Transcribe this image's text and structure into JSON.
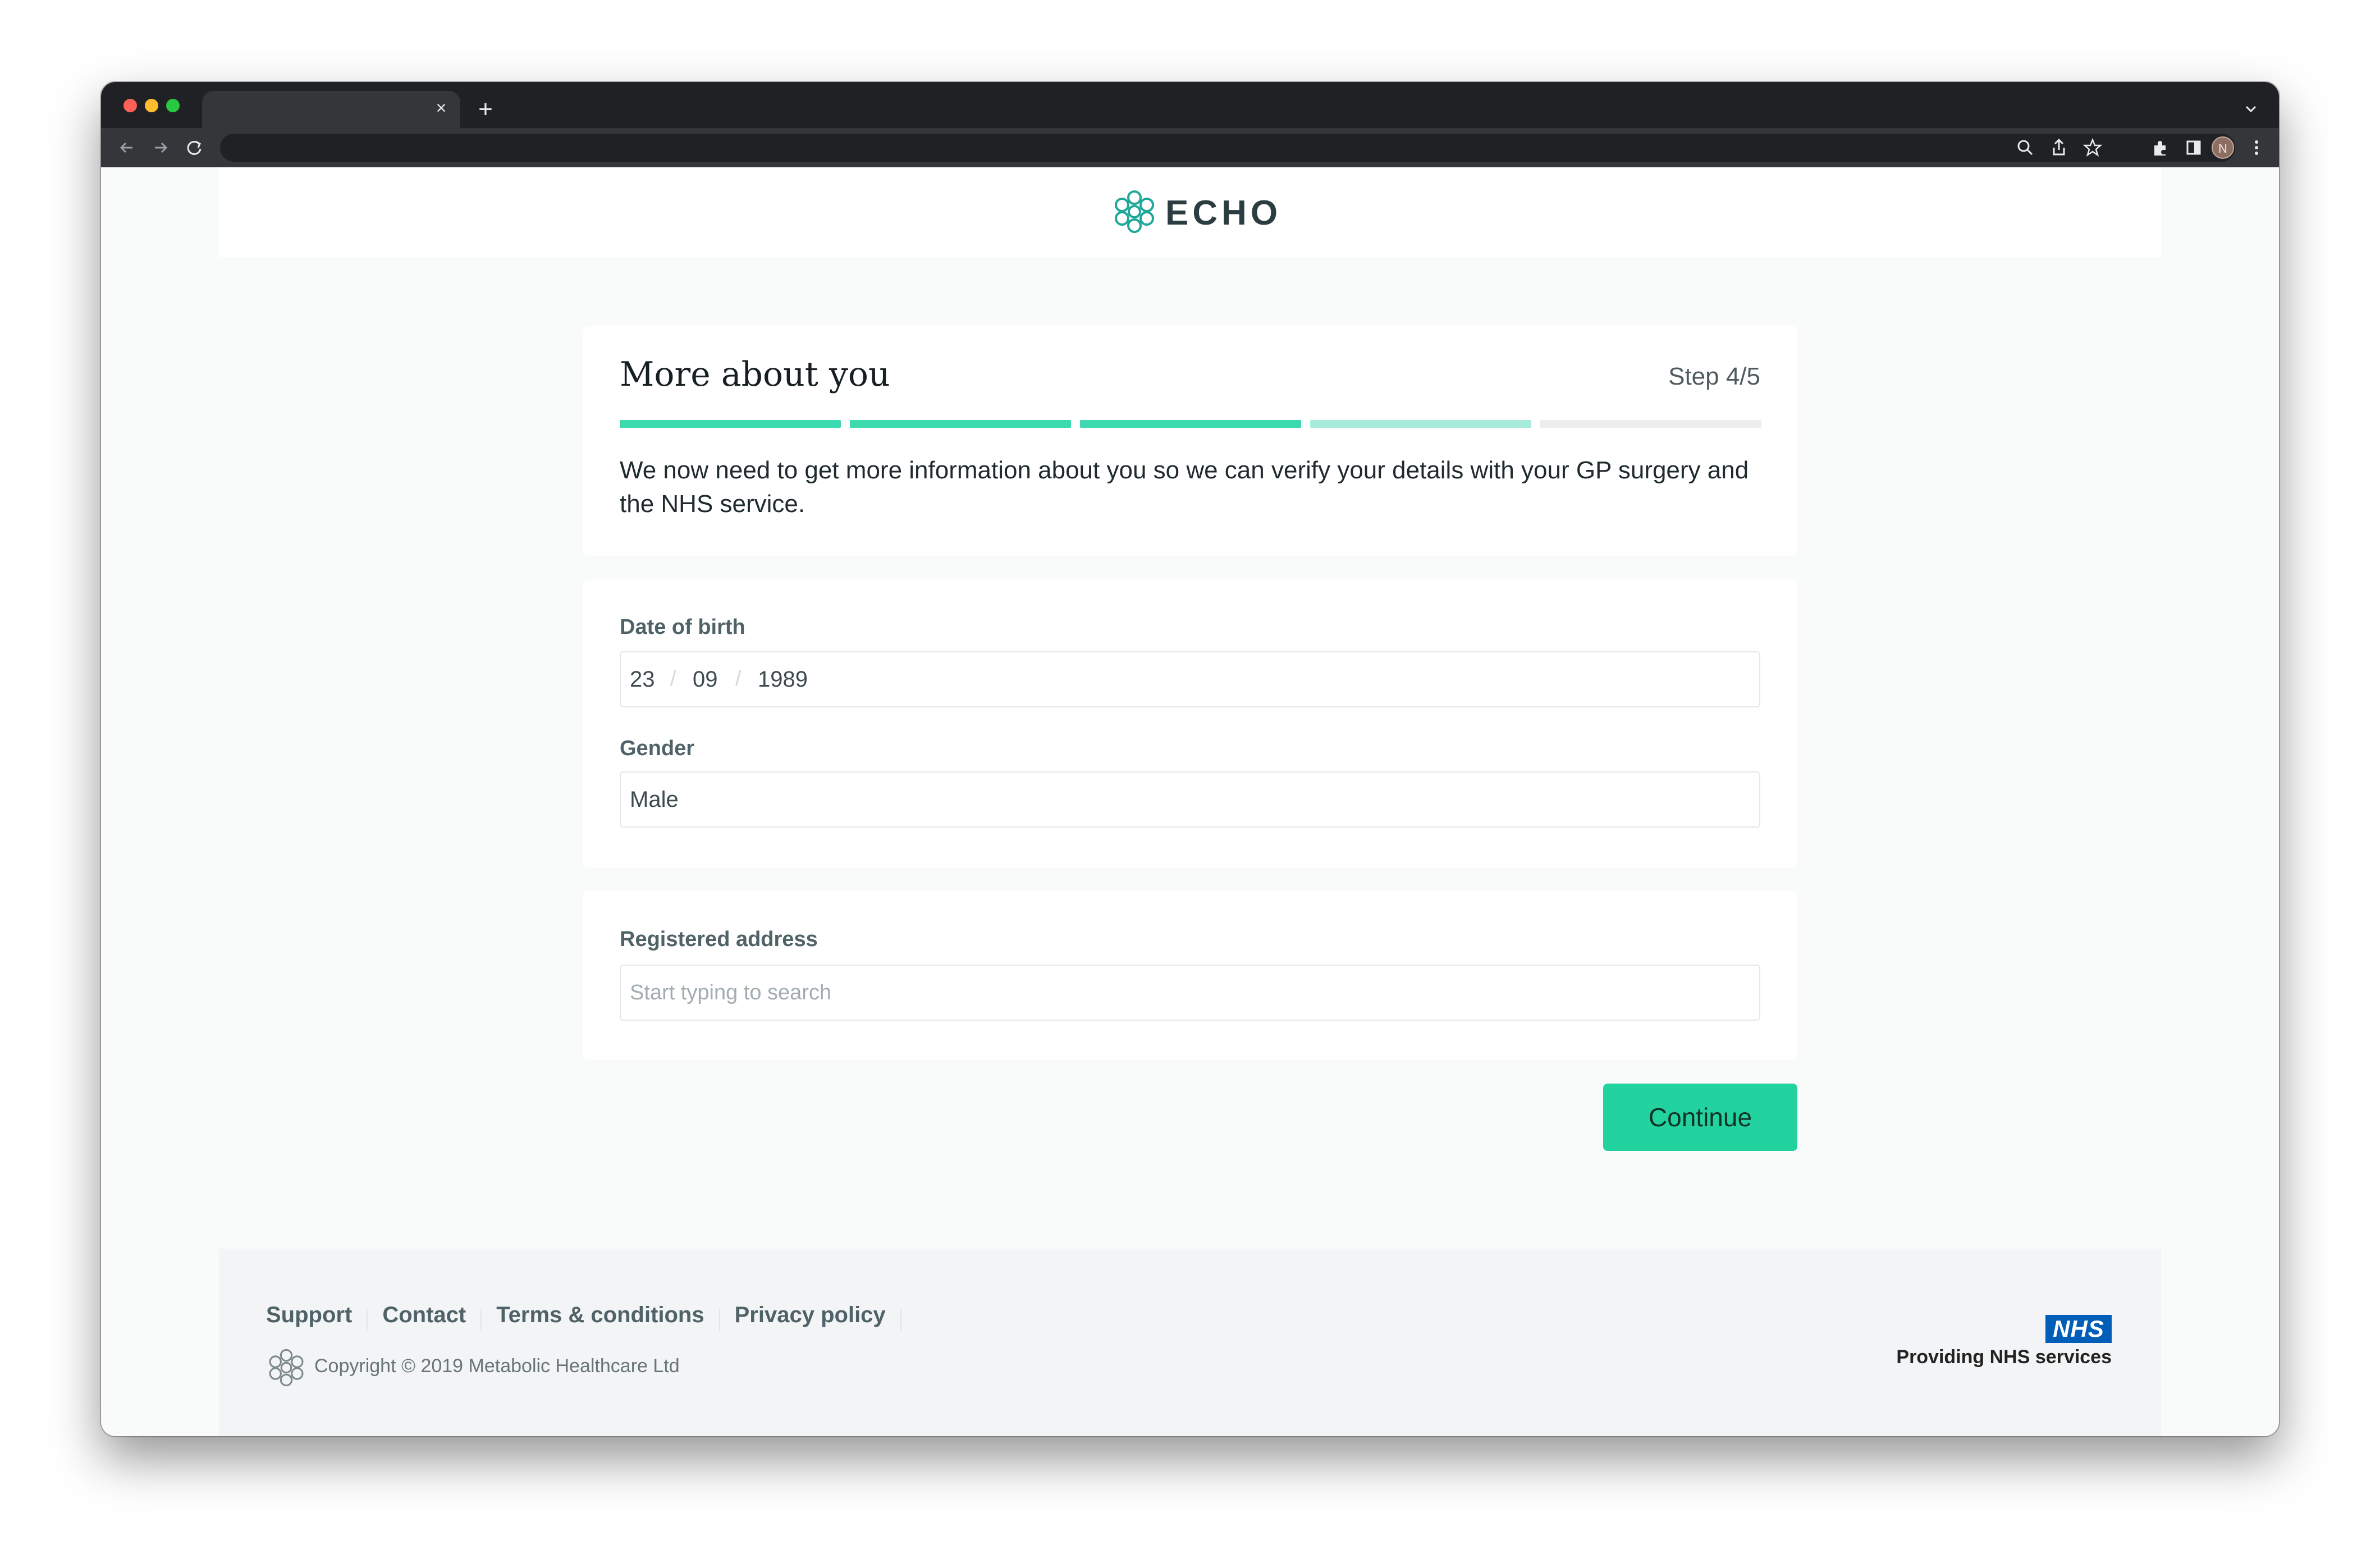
{
  "browser": {
    "tab_close": "×",
    "new_tab": "+",
    "profile_initial": "N"
  },
  "brand": {
    "name": "ECHO",
    "color": "#1fa898"
  },
  "step_card": {
    "title": "More about you",
    "step_label": "Step 4/5",
    "progress": {
      "completed_steps": 3,
      "current_step": 4,
      "total_steps": 5
    },
    "description": "We now need to get more information about you so we can verify your details with your GP surgery and the NHS service."
  },
  "form": {
    "dob_label": "Date of birth",
    "dob_day": "23",
    "dob_month": "09",
    "dob_year": "1989",
    "dob_separator": "/",
    "gender_label": "Gender",
    "gender_value": "Male",
    "address_label": "Registered address",
    "address_placeholder": "Start typing to search"
  },
  "actions": {
    "continue_label": "Continue",
    "accent": "#22d3a0"
  },
  "footer": {
    "links": [
      "Support",
      "Contact",
      "Terms & conditions",
      "Privacy policy"
    ],
    "copyright": "Copyright © 2019 Metabolic Healthcare Ltd",
    "nhs_logo": "NHS",
    "nhs_text": "Providing NHS services",
    "nhs_color": "#005eb8"
  },
  "colors": {
    "progress_done": "#3ddab0",
    "progress_current": "#a7ebda",
    "progress_todo": "#ebedee"
  }
}
